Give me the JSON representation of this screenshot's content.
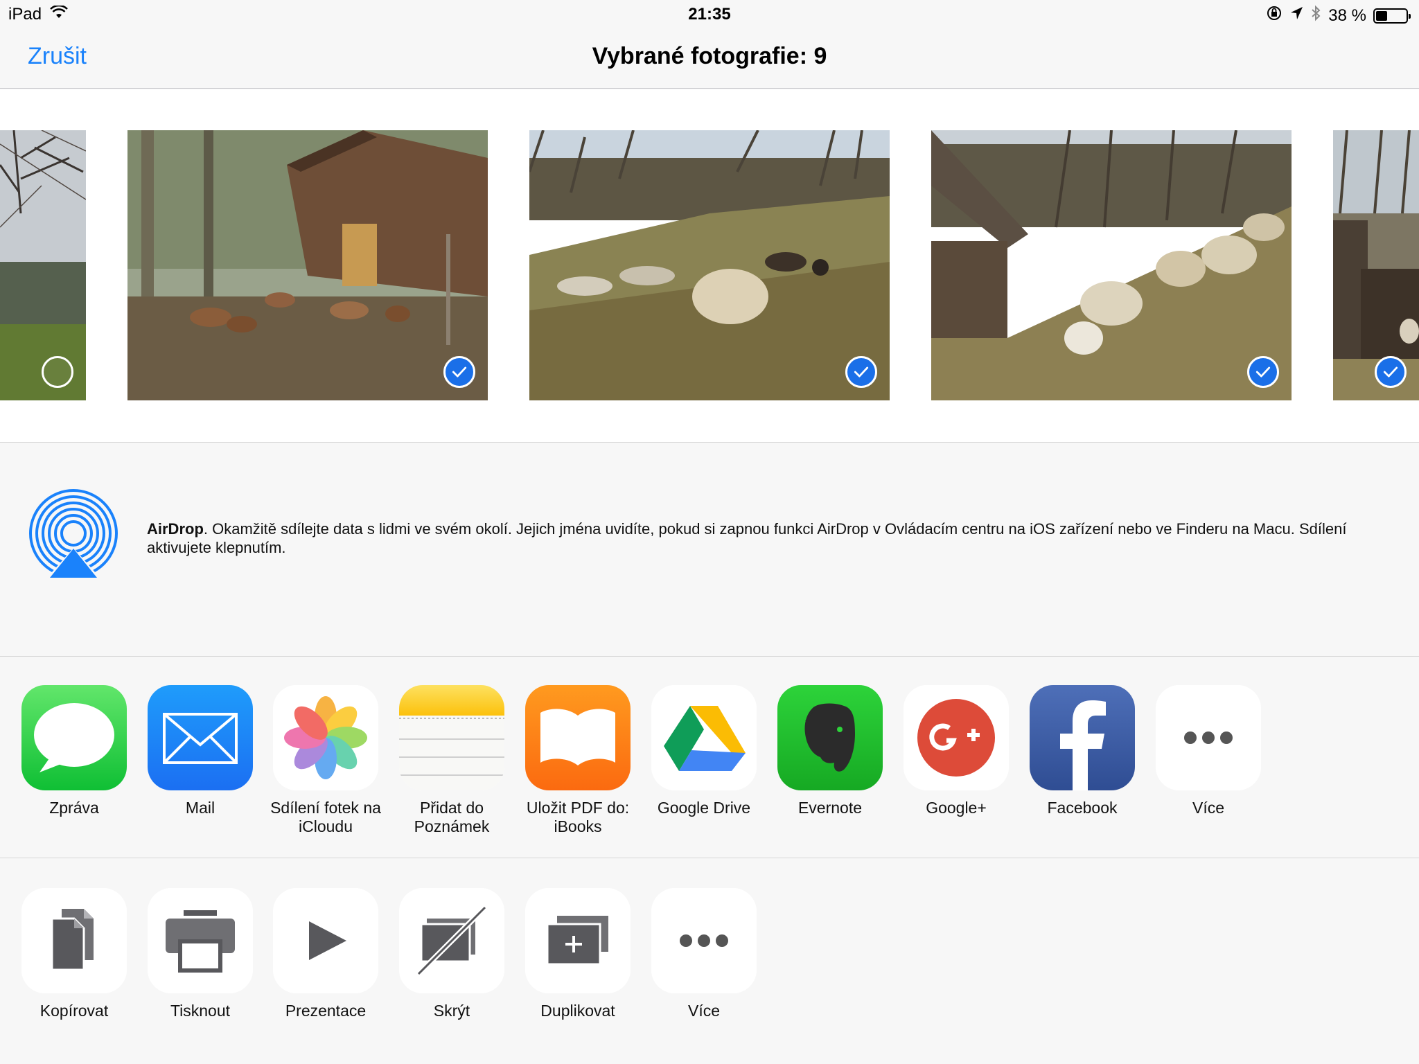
{
  "status_bar": {
    "device": "iPad",
    "time": "21:35",
    "battery": "38 %",
    "battery_level": 0.38
  },
  "nav": {
    "cancel_label": "Zrušit",
    "title": "Vybrané fotografie: 9"
  },
  "photos": [
    {
      "subject": "tree and meadow",
      "selected": false
    },
    {
      "subject": "goats by barn",
      "selected": true
    },
    {
      "subject": "sheep in pasture",
      "selected": true
    },
    {
      "subject": "sheep by shed",
      "selected": true
    },
    {
      "subject": "shed with sheep",
      "selected": true
    }
  ],
  "airdrop": {
    "title": "AirDrop",
    "text": ". Okamžitě sdílejte data s lidmi ve svém okolí. Jejich jména uvidíte, pokud si zapnou funkci AirDrop v Ovládacím centru na iOS zařízení nebo ve Finderu na Macu. Sdílení aktivujete klepnutím."
  },
  "share_apps": [
    {
      "label": "Zpráva",
      "icon": "messages-icon"
    },
    {
      "label": "Mail",
      "icon": "mail-icon"
    },
    {
      "label": "Sdílení fotek na iCloudu",
      "icon": "photos-icon"
    },
    {
      "label": "Přidat do Poznámek",
      "icon": "notes-icon"
    },
    {
      "label": "Uložit PDF do: iBooks",
      "icon": "ibooks-icon"
    },
    {
      "label": "Google Drive",
      "icon": "google-drive-icon"
    },
    {
      "label": "Evernote",
      "icon": "evernote-icon"
    },
    {
      "label": "Google+",
      "icon": "google-plus-icon"
    },
    {
      "label": "Facebook",
      "icon": "facebook-icon"
    },
    {
      "label": "Více",
      "icon": "more-icon"
    }
  ],
  "actions": [
    {
      "label": "Kopírovat",
      "icon": "copy-icon"
    },
    {
      "label": "Tisknout",
      "icon": "print-icon"
    },
    {
      "label": "Prezentace",
      "icon": "slideshow-icon"
    },
    {
      "label": "Skrýt",
      "icon": "hide-icon"
    },
    {
      "label": "Duplikovat",
      "icon": "duplicate-icon"
    },
    {
      "label": "Více",
      "icon": "more-icon"
    }
  ],
  "colors": {
    "accent": "#1a82fb",
    "checkmark": "#1a6fe8"
  }
}
